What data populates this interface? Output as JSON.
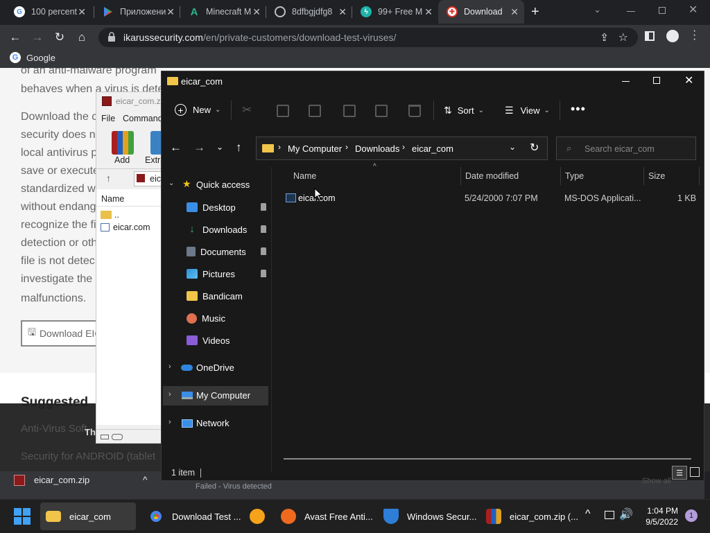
{
  "browser": {
    "tabs": [
      {
        "title": "100 percent",
        "icon": "google-g-icon"
      },
      {
        "title": "Приложени",
        "icon": "play-store-icon"
      },
      {
        "title": "Minecraft M",
        "icon": "a-logo-icon"
      },
      {
        "title": "8dfbgjdfg8",
        "icon": "globe-icon"
      },
      {
        "title": "99+ Free M",
        "icon": "lightning-icon"
      },
      {
        "title": "Download",
        "icon": "ikarus-icon"
      }
    ],
    "url_host": "ikarussecurity.com",
    "url_path": "/en/private-customers/download-test-viruses/",
    "bookmark": "Google"
  },
  "webpage": {
    "lines": [
      "of an anti-malware program",
      "behaves when a virus is dete",
      "Download the c",
      "security does n",
      "local antivirus p",
      "save or execute",
      "standardized w",
      "without endang",
      "recognize the fi",
      "detection or oth",
      "file is not detec",
      "investigate the",
      "malfunctions."
    ],
    "download_button": "Download EIC",
    "suggested": "Suggested",
    "footer_lines": [
      "Anti-Virus Soft",
      "Security for ANDROID (tablet"
    ],
    "thumb_text": "Th"
  },
  "winrar": {
    "title": "eicar_com.zi",
    "menu": [
      "File",
      "Command"
    ],
    "tools": [
      "Add",
      "Extra"
    ],
    "path": "eic",
    "col_name": "Name",
    "files": [
      "..",
      "eicar.com"
    ]
  },
  "explorer": {
    "title": "eicar_com",
    "commands": {
      "new": "New",
      "sort": "Sort",
      "view": "View"
    },
    "breadcrumb": [
      "My Computer",
      "Downloads",
      "eicar_com"
    ],
    "search_placeholder": "Search eicar_com",
    "nav": {
      "quick_access": "Quick access",
      "items": [
        "Desktop",
        "Downloads",
        "Documents",
        "Pictures",
        "Bandicam",
        "Music",
        "Videos"
      ],
      "onedrive": "OneDrive",
      "my_computer": "My Computer",
      "network": "Network"
    },
    "columns": [
      "Name",
      "Date modified",
      "Type",
      "Size"
    ],
    "files": [
      {
        "name": "eicar.com",
        "date": "5/24/2000 7:07 PM",
        "type": "MS-DOS Applicati...",
        "size": "1 KB"
      }
    ],
    "status": "1 item"
  },
  "download_bar": {
    "file": "eicar_com.zip",
    "status": "Failed - Virus detected",
    "show_all": "Show all"
  },
  "taskbar": {
    "apps": [
      "eicar_com",
      "Download Test ...",
      "Avast Free Anti...",
      "Windows Secur...",
      "eicar_com.zip (..."
    ],
    "time": "1:04 PM",
    "date": "9/5/2022",
    "notification_count": "1"
  },
  "colors": {
    "explorer_bg": "#191919",
    "selection": "#353535",
    "chrome_frame": "#202124",
    "taskbar": "#202020"
  }
}
